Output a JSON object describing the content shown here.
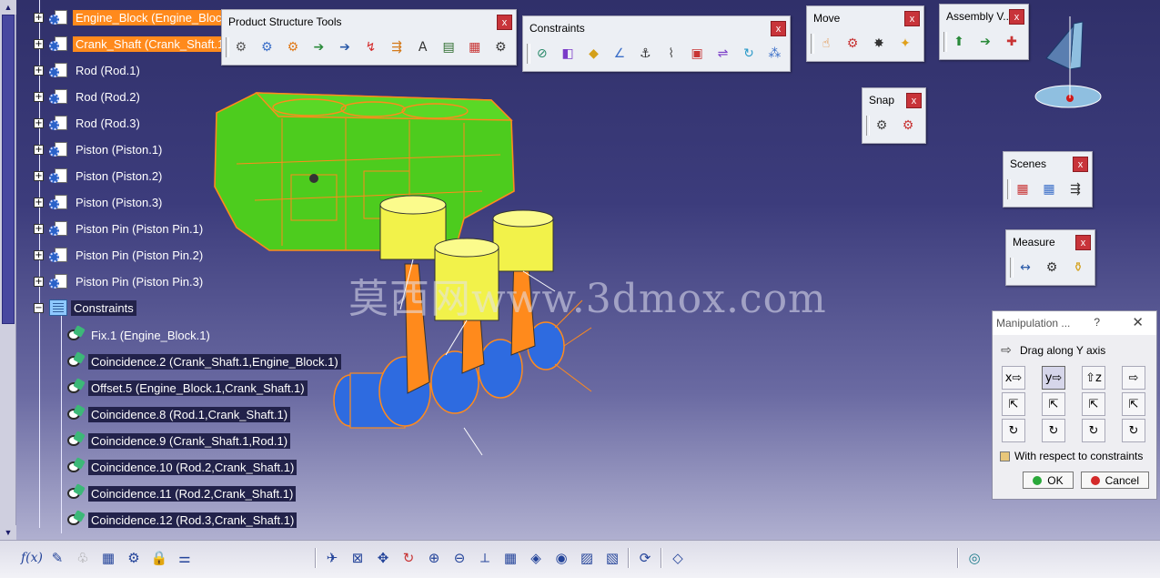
{
  "tree": {
    "parts": [
      {
        "label": "Engine_Block (Engine_Block",
        "selected": true
      },
      {
        "label": "Crank_Shaft (Crank_Shaft.1",
        "selected": true
      },
      {
        "label": "Rod (Rod.1)"
      },
      {
        "label": "Rod (Rod.2)"
      },
      {
        "label": "Rod (Rod.3)"
      },
      {
        "label": "Piston (Piston.1)"
      },
      {
        "label": "Piston (Piston.2)"
      },
      {
        "label": "Piston (Piston.3)"
      },
      {
        "label": "Piston Pin (Piston Pin.1)"
      },
      {
        "label": "Piston Pin (Piston Pin.2)"
      },
      {
        "label": "Piston Pin (Piston Pin.3)"
      }
    ],
    "constraints_label": "Constraints",
    "constraints": [
      "Fix.1 (Engine_Block.1)",
      "Coincidence.2 (Crank_Shaft.1,Engine_Block.1)",
      "Offset.5 (Engine_Block.1,Crank_Shaft.1)",
      "Coincidence.8 (Rod.1,Crank_Shaft.1)",
      "Coincidence.9 (Crank_Shaft.1,Rod.1)",
      "Coincidence.10 (Rod.2,Crank_Shaft.1)",
      "Coincidence.11 (Rod.2,Crank_Shaft.1)",
      "Coincidence.12 (Rod.3,Crank_Shaft.1)"
    ]
  },
  "toolbars": {
    "product_structure": {
      "title": "Product Structure Tools",
      "close": "x"
    },
    "constraints": {
      "title": "Constraints",
      "close": "x"
    },
    "move": {
      "title": "Move",
      "close": "x"
    },
    "assembly": {
      "title": "Assembly V...",
      "close": "x"
    },
    "snap": {
      "title": "Snap",
      "close": "x"
    },
    "scenes": {
      "title": "Scenes",
      "close": "x"
    },
    "measure": {
      "title": "Measure",
      "close": "x"
    }
  },
  "manipulation": {
    "title": "Manipulation ...",
    "help": "?",
    "close": "✕",
    "mode_label": "Drag along Y axis",
    "check_label": "With respect to constraints",
    "ok_label": "OK",
    "cancel_label": "Cancel",
    "ok_color": "#2aa83a",
    "cancel_color": "#d42a2a"
  },
  "watermark": "莫西网www.3dmox.com",
  "bottom": {
    "fx_label": "f(x)"
  },
  "colors": {
    "selection": "#ff8a1c",
    "engine_block": "#4dcc1e",
    "crank": "#2e6be0",
    "piston": "#f2f24a",
    "close": "#c8343a"
  }
}
